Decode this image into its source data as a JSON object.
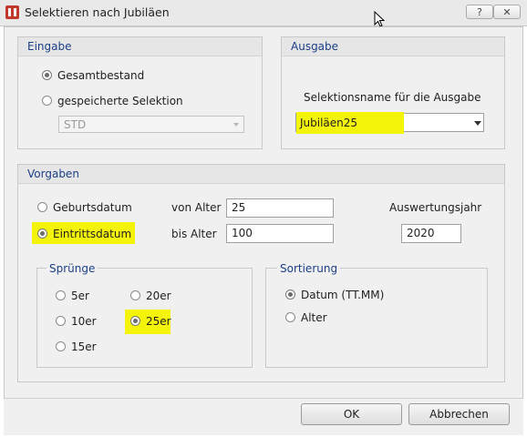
{
  "window": {
    "title": "Selektieren nach Jubiläen",
    "help_label": "?",
    "close_label": "✕"
  },
  "eingabe": {
    "title": "Eingabe",
    "options": [
      {
        "label": "Gesamtbestand",
        "selected": true
      },
      {
        "label": "gespeicherte Selektion",
        "selected": false
      }
    ],
    "selection_combo": {
      "value": "STD",
      "enabled": false
    }
  },
  "ausgabe": {
    "title": "Ausgabe",
    "name_label": "Selektionsname für die Ausgabe",
    "name_combo": {
      "value": "Jubiläen25"
    }
  },
  "vorgaben": {
    "title": "Vorgaben",
    "date_options": [
      {
        "label": "Geburtsdatum",
        "selected": false
      },
      {
        "label": "Eintrittsdatum",
        "selected": true
      }
    ],
    "von_alter": {
      "label": "von Alter",
      "value": "25"
    },
    "bis_alter": {
      "label": "bis Alter",
      "value": "100"
    },
    "auswertungsjahr": {
      "label": "Auswertungsjahr",
      "value": "2020"
    },
    "spruenge": {
      "title": "Sprünge",
      "options": [
        {
          "label": "5er",
          "selected": false
        },
        {
          "label": "20er",
          "selected": false
        },
        {
          "label": "10er",
          "selected": false
        },
        {
          "label": "25er",
          "selected": true
        },
        {
          "label": "15er",
          "selected": false
        }
      ]
    },
    "sortierung": {
      "title": "Sortierung",
      "options": [
        {
          "label": "Datum (TT.MM)",
          "selected": true
        },
        {
          "label": "Alter",
          "selected": false
        }
      ]
    }
  },
  "footer": {
    "ok_label": "OK",
    "cancel_label": "Abbrechen"
  },
  "colors": {
    "highlight": "#f4f40a",
    "group_title": "#1b3f86",
    "app_icon": "#c0392b"
  }
}
